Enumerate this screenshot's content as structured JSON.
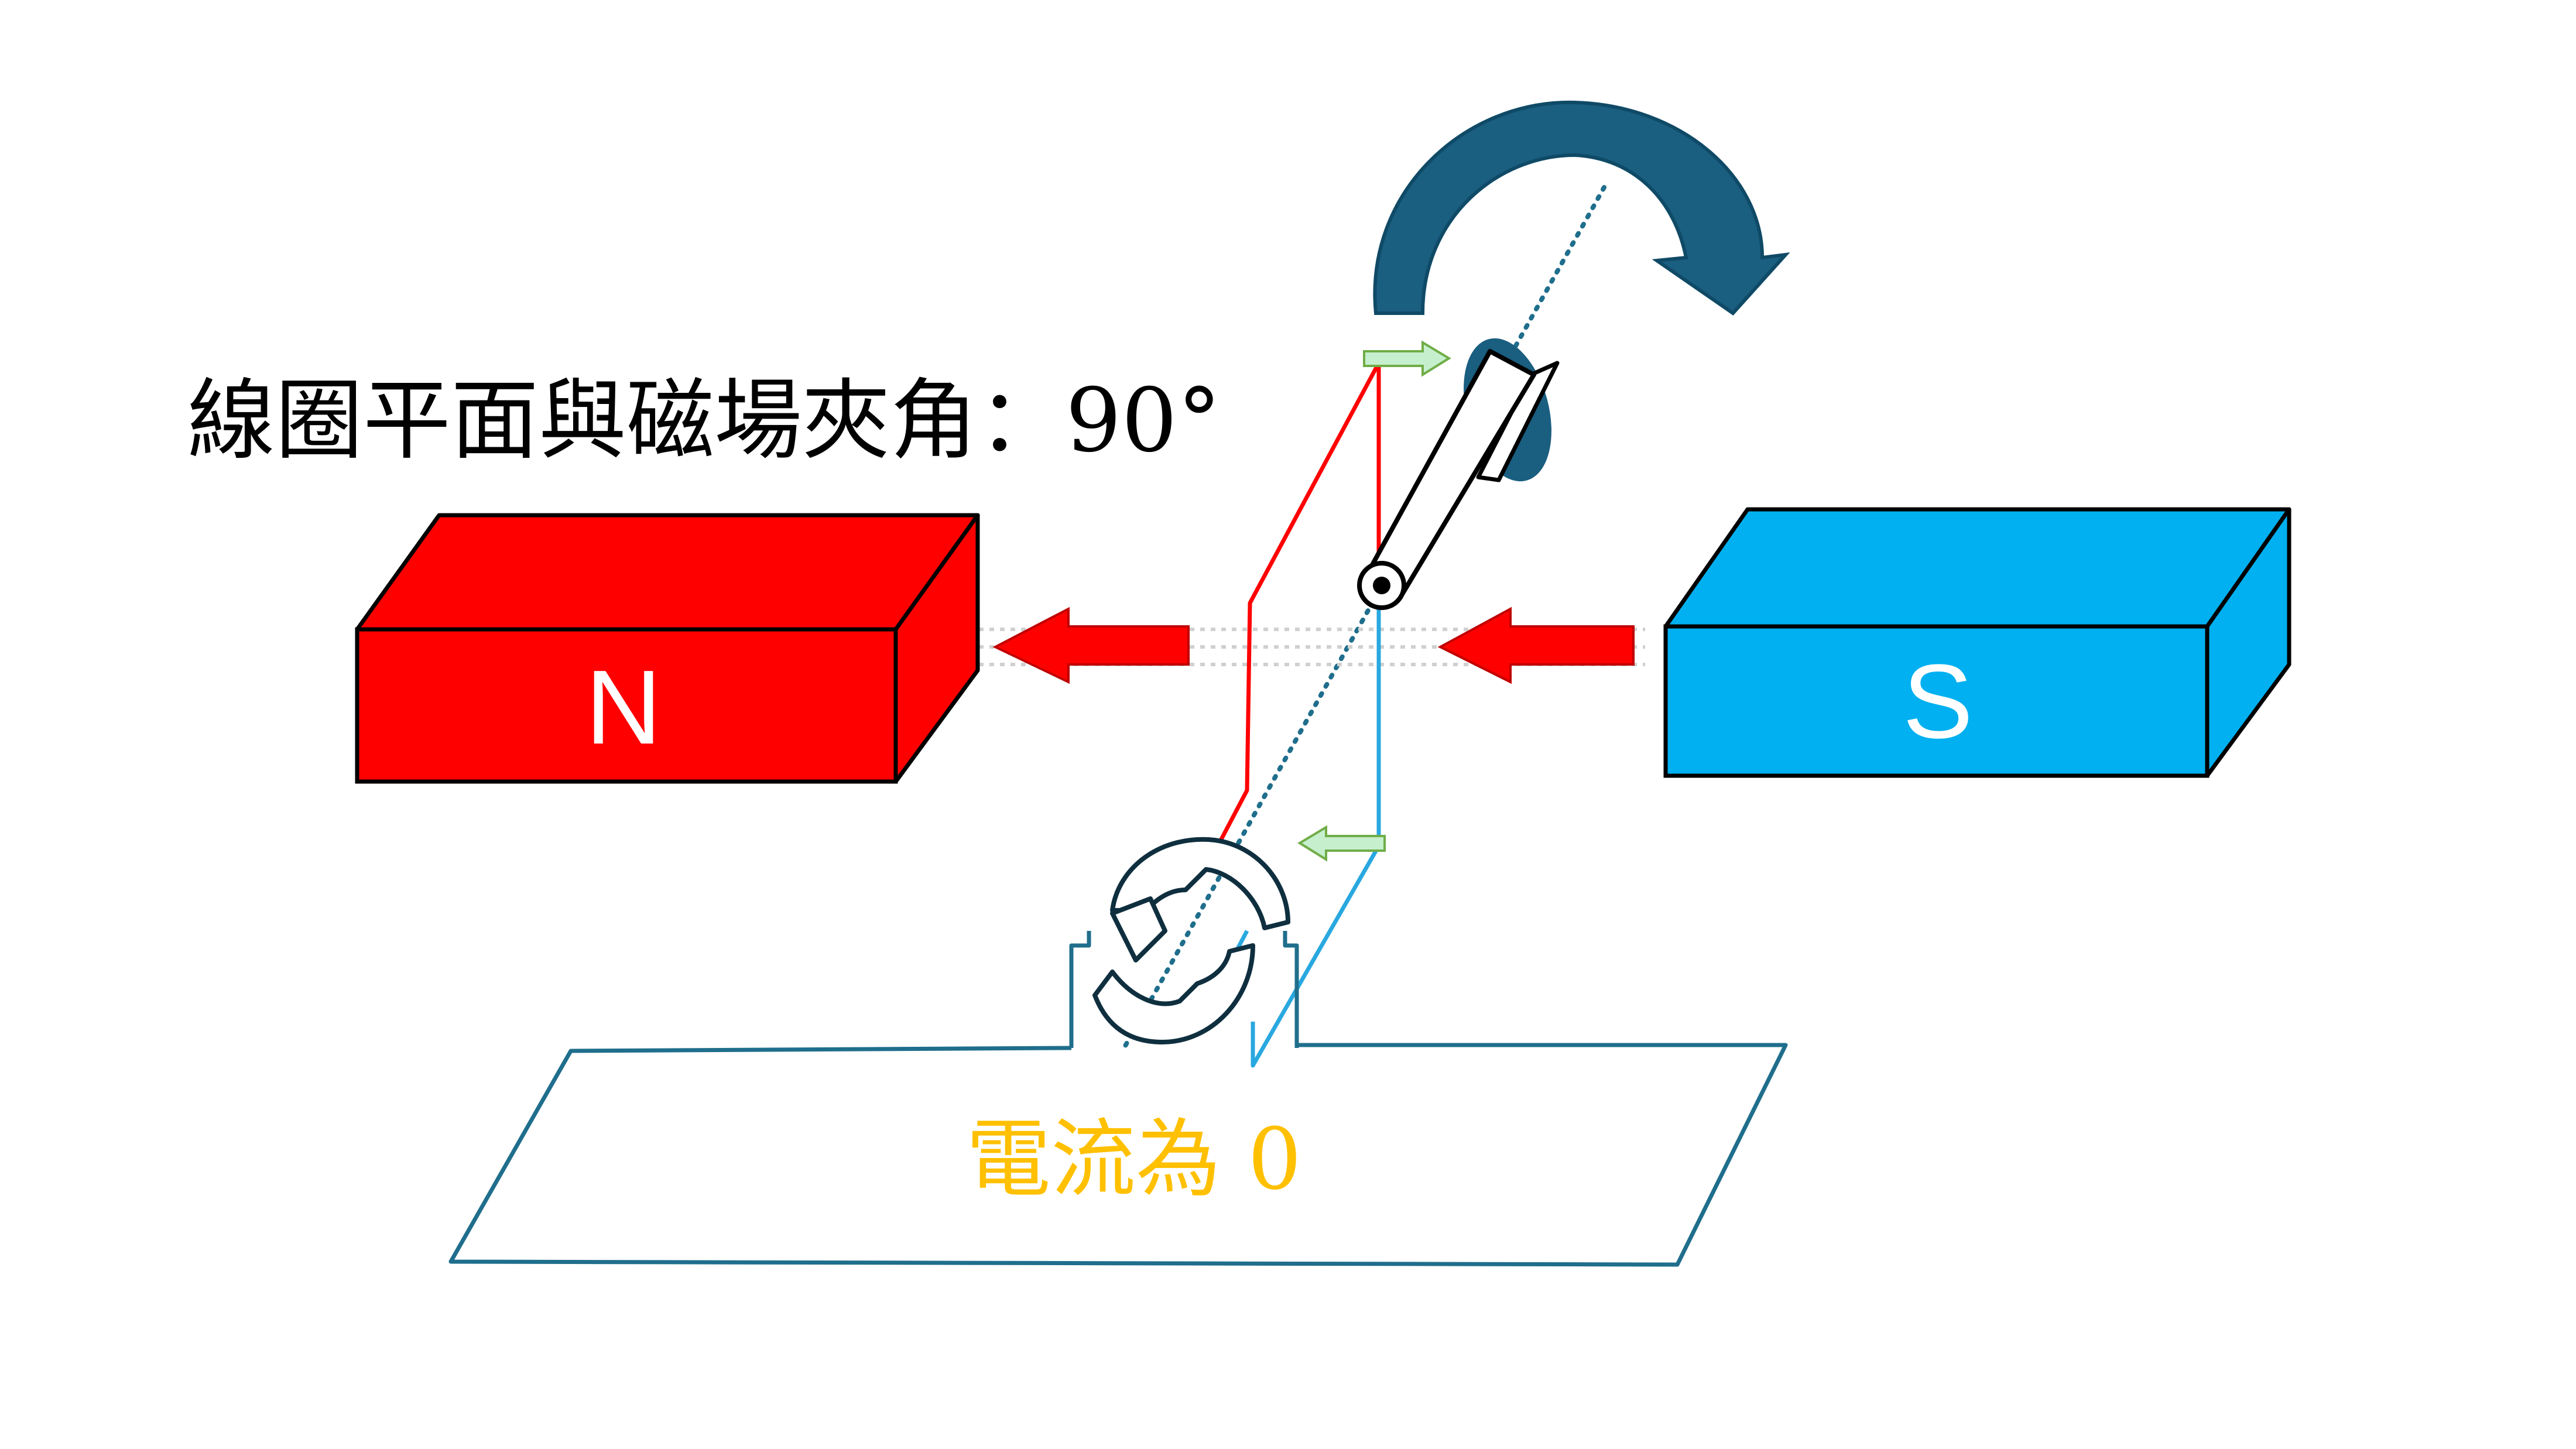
{
  "title": "線圈平面與磁場夾角：90°",
  "magnets": {
    "north": {
      "label": "N",
      "color": "#FF0000"
    },
    "south": {
      "label": "S",
      "color": "#00B0F0"
    }
  },
  "status": {
    "text": "電流為 0",
    "color": "#FFC000"
  },
  "colors": {
    "rotation_arrow": "#1A5E80",
    "base_outline": "#1F6E8C",
    "wire_red": "#FF0000",
    "wire_blue": "#29A8E0",
    "field_arrow": "#FF0000",
    "force_arrow_fill": "#C6EFCE",
    "force_arrow_stroke": "#70AD47"
  },
  "icons": {
    "rotation": "curved-rotation-arrow-icon",
    "field": "field-direction-arrow-icon",
    "force": "force-arrow-icon"
  }
}
